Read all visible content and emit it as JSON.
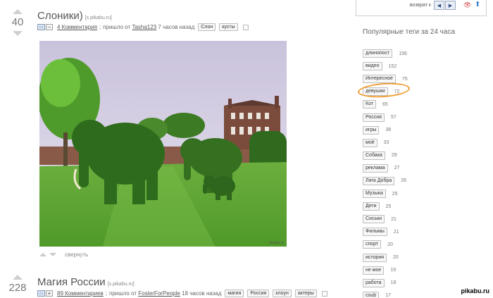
{
  "post1": {
    "rating": "40",
    "title": "Слоники)",
    "source": "[s.pikabu.ru]",
    "comment_toggle": "–",
    "comments_link": "4 Комментария",
    "from_text": "пришло от",
    "author": "Tasha123",
    "time": "7 часов назад",
    "tags": [
      "Слон",
      "кусты"
    ],
    "image_watermark": "pikabu.ru"
  },
  "collapse_label": "свернуть",
  "post2": {
    "rating": "228",
    "title": "Магия России",
    "source": "[s.pikabu.ru]",
    "comment_toggle": "+",
    "comments_link": "89 Комментариев",
    "from_text": "пришло от",
    "author": "FosterForPeople",
    "time": "18 часов назад",
    "tags": [
      "магия",
      "Россия",
      "клоун",
      "актеры"
    ]
  },
  "top_box": {
    "page_num": "1",
    "back_label": "возврат к"
  },
  "sidebar": {
    "heading": "Популярные теги за 24 часа",
    "tags": [
      {
        "name": "длинопост",
        "count": "156"
      },
      {
        "name": "видео",
        "count": "152"
      },
      {
        "name": "Интересное",
        "count": "75"
      },
      {
        "name": "девушки",
        "count": "72"
      },
      {
        "name": "Кот",
        "count": "65"
      },
      {
        "name": "Россия",
        "count": "57"
      },
      {
        "name": "игры",
        "count": "38"
      },
      {
        "name": "моё",
        "count": "33"
      },
      {
        "name": "Собака",
        "count": "29"
      },
      {
        "name": "реклама",
        "count": "27"
      },
      {
        "name": "Лига Добра",
        "count": "26"
      },
      {
        "name": "Музыка",
        "count": "25"
      },
      {
        "name": "Дети",
        "count": "25"
      },
      {
        "name": "Сиськи",
        "count": "21"
      },
      {
        "name": "Фильмы",
        "count": "21"
      },
      {
        "name": "спорт",
        "count": "20"
      },
      {
        "name": "история",
        "count": "20"
      },
      {
        "name": "не мое",
        "count": "19"
      },
      {
        "name": "работа",
        "count": "18"
      },
      {
        "name": "coub",
        "count": "17"
      }
    ]
  },
  "watermark": "pikabu.ru",
  "colors": {
    "highlight": "#f0a03a",
    "link": "#555555",
    "nav_button": "#e9eef6"
  }
}
